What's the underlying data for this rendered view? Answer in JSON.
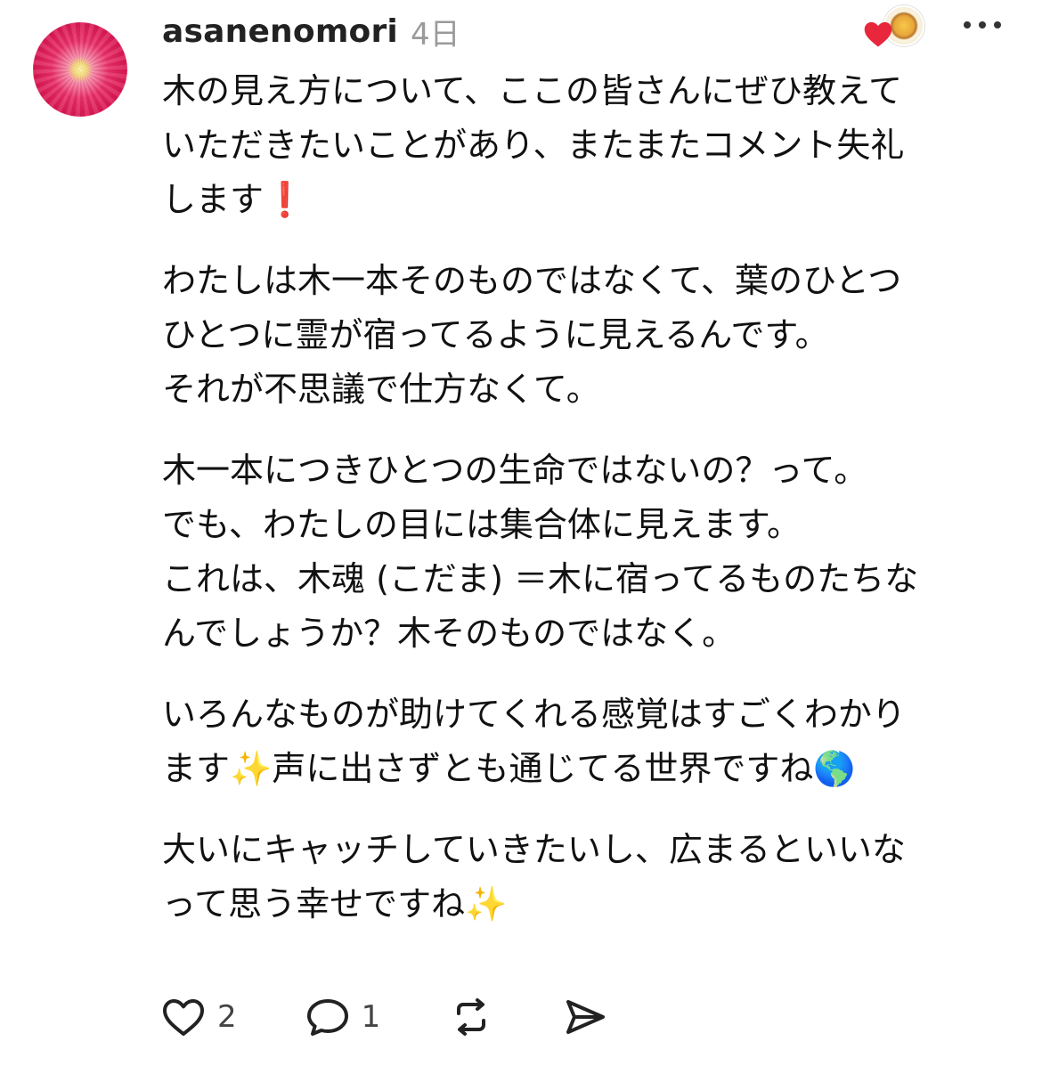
{
  "comment": {
    "username": "asanenomori",
    "time": "4日",
    "reaction_icon": "heart-icon",
    "more_icon": "more-dots-icon",
    "paragraphs": [
      {
        "lines": [
          "木の見え方について、ここの皆さんにぜひ教えて",
          "いただきたいことがあり、またまたコメント失礼",
          "します❗️"
        ]
      },
      {
        "lines": [
          "わたしは木一本そのものではなくて、葉のひとつ",
          "ひとつに霊が宿ってるように見えるんです。",
          "それが不思議で仕方なくて。"
        ]
      },
      {
        "lines": [
          "木一本につきひとつの生命ではないの？って。",
          "でも、わたしの目には集合体に見えます。",
          "これは、木魂 (こだま) ＝木に宿ってるものたちな",
          "んでしょうか？木そのものではなく。"
        ]
      },
      {
        "lines": [
          "いろんなものが助けてくれる感覚はすごくわかり",
          "ます✨声に出さずとも通じてる世界ですね🌎"
        ]
      },
      {
        "lines": [
          "大いにキャッチしていきたいし、広まるといいな",
          "って思う幸せですね✨"
        ]
      }
    ]
  },
  "actions": {
    "like_count": "2",
    "reply_count": "1",
    "like_icon": "heart-outline-icon",
    "reply_icon": "speech-bubble-icon",
    "repost_icon": "repost-icon",
    "share_icon": "send-icon"
  },
  "colors": {
    "text": "#111111",
    "muted": "#9a9a9a",
    "heart_red": "#e8263c",
    "avatar_pink": "#d91852"
  }
}
